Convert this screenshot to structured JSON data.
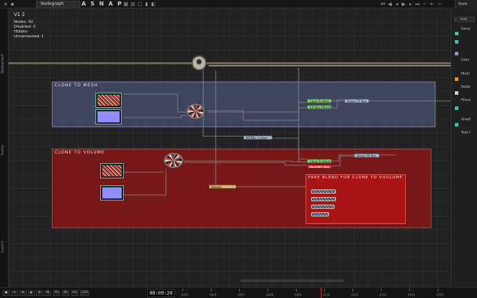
{
  "toolbar": {
    "tab_title": "Nodegraph",
    "snap_label": "A S N A P",
    "right_header": "Node"
  },
  "canvas": {
    "version": "V1 2",
    "stats": {
      "nodes": "Nodes: 42",
      "disabled": "Disabled: 3",
      "hidden": "Hidden:",
      "unconnected": "Unconnected: 1"
    },
    "backdrops": {
      "mesh_title": "CLONE TO MESH",
      "volume_title": "CLONE TO VOLUME",
      "fake_title": "FAKE BLEND FOR CLONE TO VOULUME"
    },
    "nodes": {
      "clone_to_mesh": "Clone To Mesh",
      "kill_box_effector": "Kill Box Effector",
      "shape_to_box_1": "Shape TO Box",
      "model_instant": "MODEL: Instant",
      "clone_to_volume": "Clone To Volume",
      "boundary_box": "Boundary Box",
      "shape_to_box_2": "Shape TO Box",
      "density": "Density"
    }
  },
  "left_gutter": {
    "labels": [
      "Nodegraph",
      "Scene",
      "Layers"
    ]
  },
  "right_panel": {
    "items": [
      {
        "label": "Gene",
        "color": "#3fbfae"
      },
      {
        "label": "Inter",
        "color": "#3fbfae"
      },
      {
        "label": "Modi",
        "color": "#8d9bd0"
      },
      {
        "label": "Node",
        "color": "#e0a030"
      },
      {
        "label": "Proce",
        "color": "#d0d0d0"
      },
      {
        "label": "Shadi",
        "color": "#3fbfae"
      },
      {
        "label": "Text I",
        "color": "#3fbfae"
      }
    ],
    "search_label": "text"
  },
  "bottombar": {
    "buttons": [
      "IN",
      "RS",
      "BS",
      "HS",
      "LOG"
    ],
    "timecode": "00:09:20",
    "ruler_labels": [
      "2005",
      "2006",
      "2007",
      "2008",
      "2009",
      "2010",
      "2011",
      "2012",
      "2013",
      "2014"
    ]
  }
}
